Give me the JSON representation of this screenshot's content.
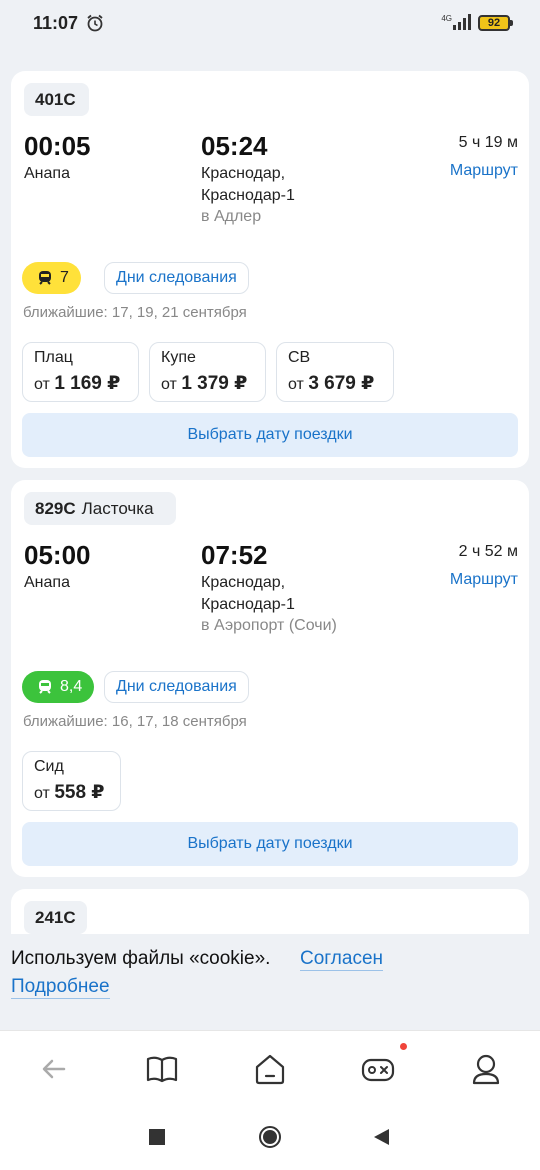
{
  "status": {
    "time": "11:07",
    "network": "4G",
    "battery": "92"
  },
  "cards": [
    {
      "train": "401С",
      "train_name": "",
      "dep_time": "00:05",
      "dep_station": "Анапа",
      "arr_time": "05:24",
      "arr_station_1": "Краснодар,",
      "arr_station_2": "Краснодар-1",
      "direction": "в Адлер",
      "duration": "5 ч 19 м",
      "route": "Маршрут",
      "rating": "7",
      "days": "Дни следования",
      "nearest": "ближайшие: 17, 19, 21 сентября",
      "prices": [
        {
          "cls": "Плац",
          "from": "от",
          "price": "1 169 ₽"
        },
        {
          "cls": "Купе",
          "from": "от",
          "price": "1 379 ₽"
        },
        {
          "cls": "СВ",
          "from": "от",
          "price": "3 679 ₽"
        }
      ],
      "choose": "Выбрать дату поездки"
    },
    {
      "train": "829С",
      "train_name": "Ласточка",
      "dep_time": "05:00",
      "dep_station": "Анапа",
      "arr_time": "07:52",
      "arr_station_1": "Краснодар,",
      "arr_station_2": "Краснодар-1",
      "direction": "в Аэропорт (Сочи)",
      "duration": "2 ч 52 м",
      "route": "Маршрут",
      "rating": "8,4",
      "days": "Дни следования",
      "nearest": "ближайшие: 16, 17, 18 сентября",
      "prices": [
        {
          "cls": "Сид",
          "from": "от",
          "price": "558 ₽"
        }
      ],
      "choose": "Выбрать дату поездки"
    },
    {
      "train": "241С"
    }
  ],
  "cookie": {
    "text": "Используем файлы «cookie».",
    "agree": "Согласен",
    "more": "Подробнее"
  },
  "nav_icons": [
    "back-arrow-icon",
    "book-icon",
    "home-icon",
    "gamepad-icon",
    "profile-icon"
  ],
  "colors": {
    "accent": "#1a73c9",
    "rating_yellow": "#ffe13a",
    "rating_green": "#3cc33c",
    "notification": "#f0443a"
  }
}
